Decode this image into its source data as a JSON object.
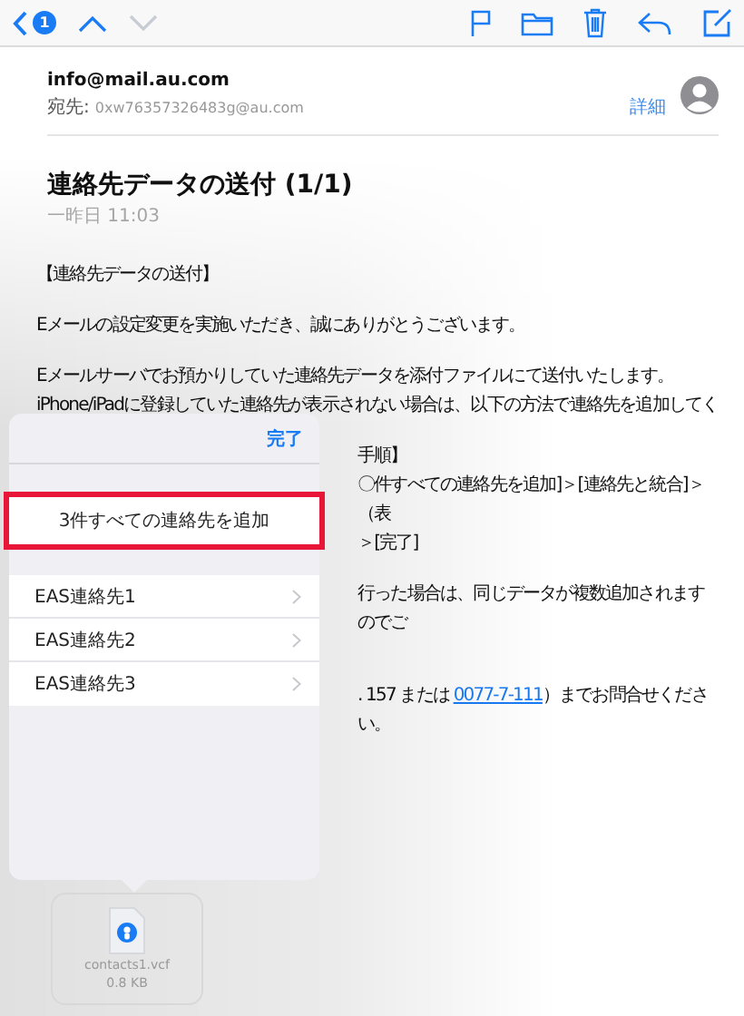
{
  "toolbar": {
    "back_badge": "1",
    "up_disabled": false,
    "down_disabled": true
  },
  "message": {
    "from": "info@mail.au.com",
    "to_label": "宛先:",
    "to": "0xw76357326483g@au.com",
    "details": "詳細",
    "subject": "連絡先データの送付 (1/1)",
    "date": "一昨日 11:03"
  },
  "body": [
    {
      "kind": "line",
      "text": "【連絡先データの送付】"
    },
    {
      "kind": "gap"
    },
    {
      "kind": "line",
      "text": "Eメールの設定変更を実施いただき、誠にありがとうございます。"
    },
    {
      "kind": "gap"
    },
    {
      "kind": "line",
      "text": "Eメールサーバでお預かりしていた連絡先データを添付ファイルにて送付いたします。"
    },
    {
      "kind": "line",
      "text": "iPhone/iPadに登録していた連絡先が表示されない場合は、以下の方法で連絡先を追加してく"
    },
    {
      "kind": "gap"
    },
    {
      "kind": "partial",
      "text": "手順】"
    },
    {
      "kind": "partial",
      "text": "〇件すべての連絡先を追加]＞[連絡先と統合]＞（表"
    },
    {
      "kind": "partial",
      "text": "＞[完了]"
    },
    {
      "kind": "gap"
    },
    {
      "kind": "partial",
      "text": "行った場合は、同じデータが複数追加されますのでご"
    },
    {
      "kind": "gap"
    },
    {
      "kind": "gap"
    },
    {
      "kind": "partial_link",
      "before": ". 157 または ",
      "link": "0077-7-111",
      "after": "）までお問合せください。"
    }
  ],
  "attachment": {
    "name": "contacts1.vcf",
    "size": "0.8 KB"
  },
  "popover": {
    "done": "完了",
    "add_all": "3件すべての連絡先を追加",
    "add_all_highlighted": true,
    "contacts": [
      "EAS連絡先1",
      "EAS連絡先2",
      "EAS連絡先3"
    ]
  }
}
